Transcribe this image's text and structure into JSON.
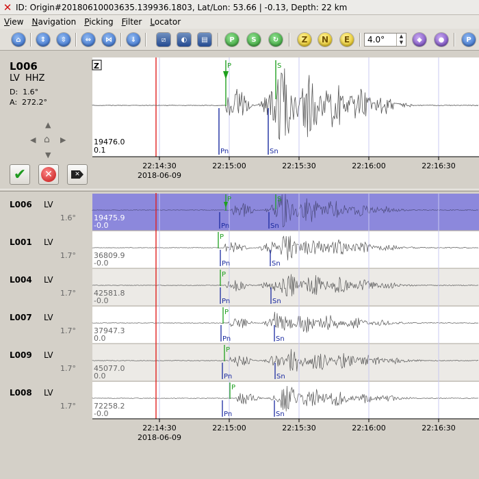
{
  "window": {
    "title": "ID: Origin#20180610003635.139936.1803, Lat/Lon: 53.66 | -0.13, Depth: 22 km"
  },
  "menu": [
    {
      "label": "View",
      "u": "V"
    },
    {
      "label": "Navigation",
      "u": "N"
    },
    {
      "label": "Picking",
      "u": "P"
    },
    {
      "label": "Filter",
      "u": "F"
    },
    {
      "label": "Locator",
      "u": "L"
    }
  ],
  "toolbar": {
    "spin_value": "4.0°",
    "comp_z": "Z",
    "comp_n": "N",
    "comp_e": "E",
    "last_button": "P"
  },
  "current": {
    "station": "L006",
    "channel": "LV  HHZ",
    "distance": "D:  1.6°",
    "azimuth": "A:  272.2°",
    "component": "Z",
    "amp": "19476.0",
    "scale": "0.1",
    "pick_p": "P",
    "pick_s": "S",
    "theo_pn": "Pn",
    "theo_sn": "Sn"
  },
  "time_axis": {
    "ticks": [
      "22:14:30",
      "22:15:00",
      "22:15:30",
      "22:16:00",
      "22:16:30"
    ],
    "date": "2018-06-09"
  },
  "traces": [
    {
      "station": "L006",
      "network": "LV",
      "distance": "1.6°",
      "amp": "19475.9",
      "offset": "-0.0",
      "selected": true
    },
    {
      "station": "L001",
      "network": "LV",
      "distance": "1.7°",
      "amp": "36809.9",
      "offset": "-0.0",
      "selected": false
    },
    {
      "station": "L004",
      "network": "LV",
      "distance": "1.7°",
      "amp": "42581.8",
      "offset": "-0.0",
      "selected": false
    },
    {
      "station": "L007",
      "network": "LV",
      "distance": "1.7°",
      "amp": "37947.3",
      "offset": "0.0",
      "selected": false
    },
    {
      "station": "L009",
      "network": "LV",
      "distance": "1.7°",
      "amp": "45077.0",
      "offset": "0.0",
      "selected": false
    },
    {
      "station": "L008",
      "network": "LV",
      "distance": "1.7°",
      "amp": "72258.2",
      "offset": "-0.0",
      "selected": false
    }
  ],
  "colors": {
    "pick": "#1ea01e",
    "theoretical": "#1a2aa0",
    "origin_line": "#e02020",
    "selected_row": "#8c88dc",
    "waveform": "#555555"
  }
}
